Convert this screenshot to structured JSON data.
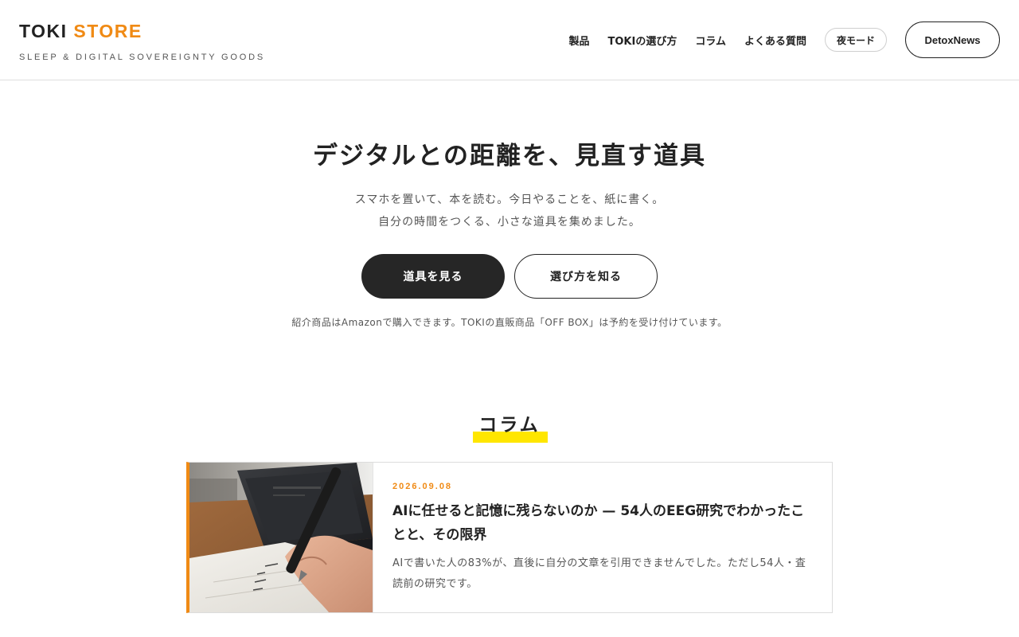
{
  "brand": {
    "name_main": "TOKI",
    "name_accent": "STORE",
    "tagline": "SLEEP & DIGITAL SOVEREIGNTY GOODS",
    "accent_color": "#f08a14"
  },
  "nav": {
    "items": [
      {
        "label": "製品"
      },
      {
        "label": "TOKIの選び方"
      },
      {
        "label": "コラム"
      },
      {
        "label": "よくある質問"
      }
    ],
    "night_mode_label": "夜モード",
    "detox_news_label": "DetoxNews"
  },
  "hero": {
    "title": "デジタルとの距離を、見直す道具",
    "line1": "スマホを置いて、本を読む。今日やることを、紙に書く。",
    "line2": "自分の時間をつくる、小さな道具を集めました。",
    "primary_button": "道具を見る",
    "secondary_button": "選び方を知る",
    "note": "紹介商品はAmazonで購入できます。TOKIの直販商品「OFF BOX」は予約を受け付けています。"
  },
  "columns": {
    "heading": "コラム",
    "highlight_color": "#ffe600",
    "articles": [
      {
        "date": "2026.09.08",
        "title": "AIに任せると記憶に残らないのか — 54人のEEG研究でわかったことと、その限界",
        "excerpt": "AIで書いた人の83%が、直後に自分の文章を引用できませんでした。ただし54人・査読前の研究です。",
        "image_icon": "pen-writing-notebook-photo"
      }
    ]
  }
}
